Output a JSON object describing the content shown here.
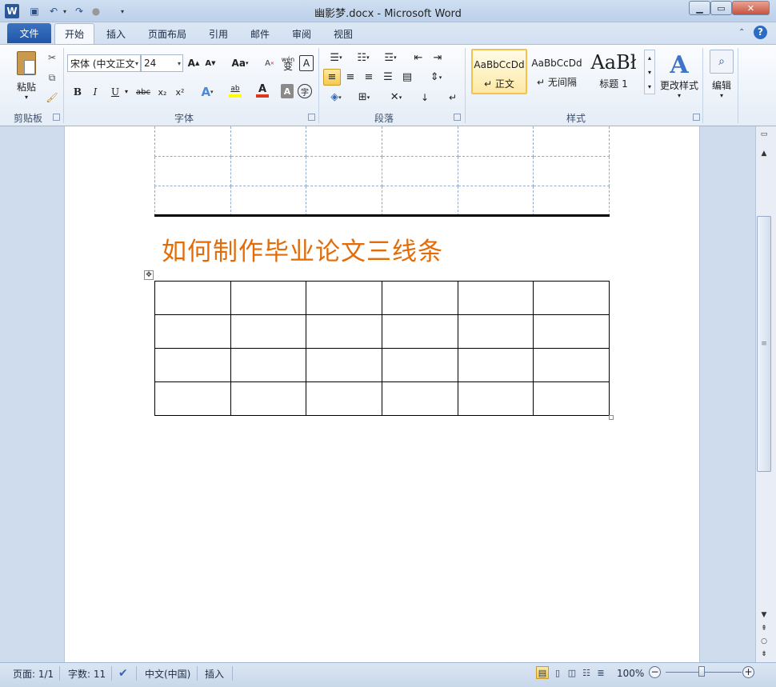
{
  "window": {
    "title": "幽影梦.docx - Microsoft Word"
  },
  "tabs": {
    "file": "文件",
    "home": "开始",
    "insert": "插入",
    "layout": "页面布局",
    "references": "引用",
    "mailings": "邮件",
    "review": "审阅",
    "view": "视图"
  },
  "clipboard": {
    "paste_label": "粘贴",
    "group_label": "剪贴板"
  },
  "font": {
    "name": "宋体 (中文正文",
    "size": "24",
    "group_label": "字体",
    "case_label": "Aa",
    "char_border_glyph": "A",
    "wen_glyph": "wén",
    "bold": "B",
    "italic": "I",
    "underline": "U",
    "strike": "abc",
    "subscript": "x₂",
    "superscript": "x²",
    "highlight_glyph": "ab",
    "color_glyph": "A",
    "shade_glyph": "A",
    "enclose_glyph": "字",
    "grow_glyph": "A",
    "shrink_glyph": "A",
    "phonetic_glyph": "变"
  },
  "paragraph": {
    "group_label": "段落"
  },
  "styles": {
    "group_label": "样式",
    "items": [
      {
        "preview": "AaBbCcDd",
        "name": "正文"
      },
      {
        "preview": "AaBbCcDd",
        "name": "无间隔"
      },
      {
        "preview": "AaBł",
        "name": "标题 1"
      }
    ],
    "change_label": "更改样式"
  },
  "editing": {
    "label": "编辑"
  },
  "document": {
    "heading": "如何制作毕业论文三线条",
    "table1": {
      "rows": 3,
      "cols": 6
    },
    "table2": {
      "rows": 4,
      "cols": 6
    }
  },
  "status": {
    "page": "页面: 1/1",
    "words": "字数: 11",
    "language": "中文(中国)",
    "mode": "插入",
    "zoom": "100%"
  },
  "colors": {
    "heading": "#e36c09",
    "file_tab": "#2a63b5"
  }
}
